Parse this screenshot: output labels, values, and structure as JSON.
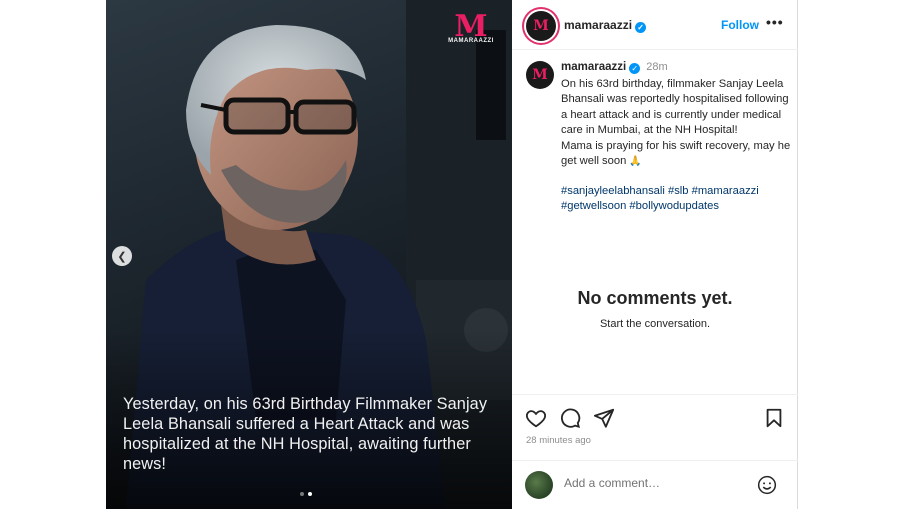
{
  "media": {
    "watermark_letter": "M",
    "watermark_text": "MAMARAAZZI",
    "caption": "Yesterday, on his 63rd Birthday Filmmaker Sanjay Leela Bhansali suffered a Heart Attack and was hospitalized at the NH Hospital, awaiting further news!",
    "slide_count": 2,
    "active_slide": 2
  },
  "header": {
    "avatar_letter": "M",
    "username": "mamaraazzi",
    "follow_label": "Follow",
    "more_label": "•••"
  },
  "post": {
    "avatar_letter": "M",
    "username": "mamaraazzi",
    "time": "28m",
    "text": "On his 63rd birthday, filmmaker Sanjay Leela Bhansali was reportedly hospitalised following a heart attack and is currently under medical care in Mumbai, at the NH Hospital!\nMama is praying for his swift recovery, may he get well soon",
    "emoji": "🙏",
    "hashtags": "#sanjayleelabhansali #slb #mamaraazzi\n#getwellsoon #bollywodupdates"
  },
  "empty_state": {
    "title": "No comments yet.",
    "subtitle": "Start the conversation."
  },
  "actions": {
    "posted_ago": "28 minutes ago"
  },
  "comment": {
    "placeholder": "Add a comment…"
  },
  "icons": [
    "chevron-left-icon",
    "heart-icon",
    "comment-icon",
    "share-icon",
    "bookmark-icon",
    "smile-icon",
    "verified-icon"
  ],
  "colors": {
    "accent": "#0095f6",
    "brand": "#e91e63"
  }
}
